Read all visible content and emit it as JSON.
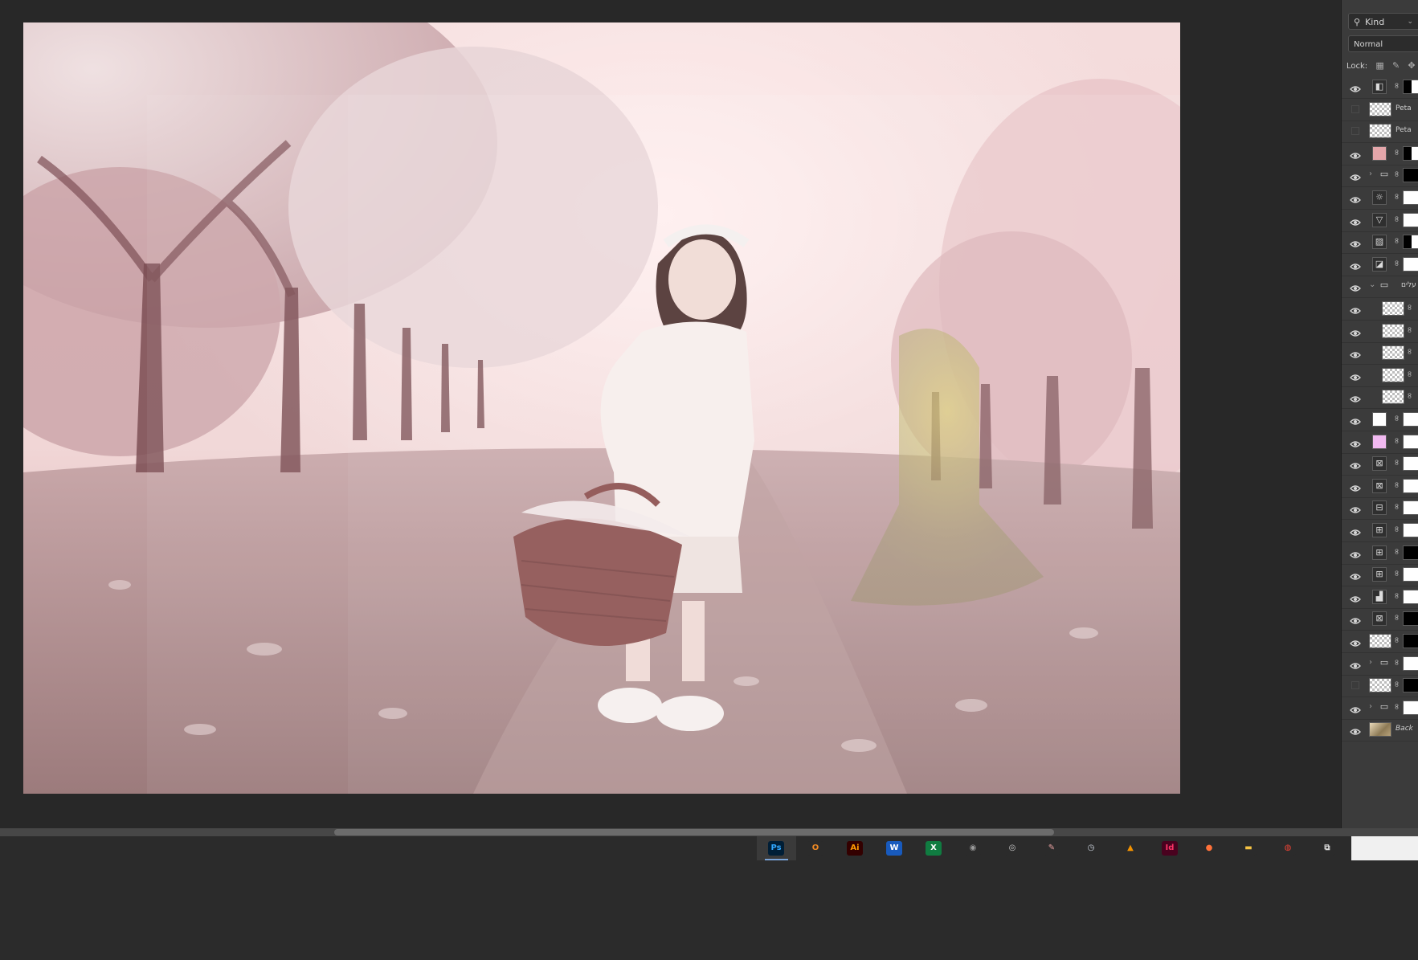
{
  "layers_panel": {
    "filter_label": "Kind",
    "blend_mode": "Normal",
    "lock_label": "Lock:",
    "layers": [
      {
        "visible": true,
        "kind": "adjustment",
        "icon": "contrast-icon",
        "name": ""
      },
      {
        "visible": false,
        "kind": "pixel",
        "icon": "smart-object-icon",
        "name": "Peta"
      },
      {
        "visible": false,
        "kind": "pixel",
        "icon": "smart-object-icon",
        "name": "Peta"
      },
      {
        "visible": true,
        "kind": "fill",
        "icon": "color-fill-icon",
        "name": ""
      },
      {
        "visible": true,
        "kind": "group",
        "icon": "folder-icon",
        "name": ""
      },
      {
        "visible": true,
        "kind": "adjustment",
        "icon": "brightness-icon",
        "name": ""
      },
      {
        "visible": true,
        "kind": "adjustment",
        "icon": "triangle-icon",
        "name": ""
      },
      {
        "visible": true,
        "kind": "adjustment",
        "icon": "curves-icon",
        "name": ""
      },
      {
        "visible": true,
        "kind": "adjustment",
        "icon": "gradient-map-icon",
        "name": ""
      },
      {
        "visible": true,
        "kind": "group-open",
        "icon": "folder-icon",
        "name": "עלים"
      },
      {
        "visible": true,
        "kind": "pixel-child",
        "icon": "smart-object-icon",
        "name": ""
      },
      {
        "visible": true,
        "kind": "pixel-child",
        "icon": "smart-object-icon",
        "name": ""
      },
      {
        "visible": true,
        "kind": "pixel-child",
        "icon": "smart-object-icon",
        "name": ""
      },
      {
        "visible": true,
        "kind": "pixel-child",
        "icon": "smart-object-icon",
        "name": ""
      },
      {
        "visible": true,
        "kind": "pixel-child",
        "icon": "smart-object-icon",
        "name": ""
      },
      {
        "visible": true,
        "kind": "fill",
        "icon": "color-fill-icon",
        "name": ""
      },
      {
        "visible": true,
        "kind": "fill",
        "icon": "color-fill-icon",
        "name": ""
      },
      {
        "visible": true,
        "kind": "adjustment",
        "icon": "channel-mixer-icon",
        "name": ""
      },
      {
        "visible": true,
        "kind": "adjustment",
        "icon": "channel-mixer-icon",
        "name": ""
      },
      {
        "visible": true,
        "kind": "adjustment",
        "icon": "color-balance-icon",
        "name": ""
      },
      {
        "visible": true,
        "kind": "adjustment",
        "icon": "color-lookup-icon",
        "name": ""
      },
      {
        "visible": true,
        "kind": "adjustment",
        "icon": "color-lookup-icon",
        "name": ""
      },
      {
        "visible": true,
        "kind": "adjustment",
        "icon": "color-lookup-icon",
        "name": ""
      },
      {
        "visible": true,
        "kind": "adjustment",
        "icon": "levels-icon",
        "name": ""
      },
      {
        "visible": true,
        "kind": "adjustment",
        "icon": "channel-mixer-icon",
        "name": ""
      },
      {
        "visible": true,
        "kind": "pixel",
        "icon": "smart-object-icon",
        "name": ""
      },
      {
        "visible": true,
        "kind": "group",
        "icon": "folder-icon",
        "name": ""
      },
      {
        "visible": false,
        "kind": "pixel",
        "icon": "smart-object-icon",
        "name": ""
      },
      {
        "visible": true,
        "kind": "group",
        "icon": "folder-icon",
        "name": ""
      },
      {
        "visible": true,
        "kind": "photo",
        "icon": "photo-thumb-icon",
        "name": "Back"
      }
    ]
  },
  "taskbar": {
    "apps": [
      {
        "name": "photoshop-icon",
        "label": "Ps",
        "bg": "#001e36",
        "fg": "#31a8ff",
        "active": true
      },
      {
        "name": "search-app-icon",
        "label": "O",
        "bg": "#2b2b2b",
        "fg": "#f08a24",
        "active": false
      },
      {
        "name": "illustrator-icon",
        "label": "Ai",
        "bg": "#330000",
        "fg": "#ff9a00",
        "active": false
      },
      {
        "name": "word-icon",
        "label": "W",
        "bg": "#185abd",
        "fg": "#ffffff",
        "active": false
      },
      {
        "name": "excel-icon",
        "label": "X",
        "bg": "#107c41",
        "fg": "#ffffff",
        "active": false
      },
      {
        "name": "camera-app-icon",
        "label": "◉",
        "bg": "#2b2b2b",
        "fg": "#9a9a9a",
        "active": false
      },
      {
        "name": "disk-utility-icon",
        "label": "◎",
        "bg": "#2b2b2b",
        "fg": "#c9c9c9",
        "active": false
      },
      {
        "name": "paint-app-icon",
        "label": "✎",
        "bg": "#2b2b2b",
        "fg": "#e5a0a0",
        "active": false
      },
      {
        "name": "clock-app-icon",
        "label": "◷",
        "bg": "#2b2b2b",
        "fg": "#cfd6e0",
        "active": false
      },
      {
        "name": "vlc-icon",
        "label": "▲",
        "bg": "#2b2b2b",
        "fg": "#f39200",
        "active": false
      },
      {
        "name": "indesign-icon",
        "label": "Id",
        "bg": "#49021f",
        "fg": "#ff3366",
        "active": false
      },
      {
        "name": "firefox-icon",
        "label": "●",
        "bg": "#2b2b2b",
        "fg": "#ff7139",
        "active": false
      },
      {
        "name": "file-explorer-icon",
        "label": "▬",
        "bg": "#2b2b2b",
        "fg": "#f6c344",
        "active": false
      },
      {
        "name": "chrome-icon",
        "label": "◍",
        "bg": "#2b2b2b",
        "fg": "#ea4335",
        "active": false
      },
      {
        "name": "task-view-icon",
        "label": "⧉",
        "bg": "#2b2b2b",
        "fg": "#d9d9d9",
        "active": false
      }
    ]
  },
  "colors": {
    "workspace": "#282828",
    "panel": "#3b3b3b",
    "canvas_tint": "#d9b5b8"
  }
}
